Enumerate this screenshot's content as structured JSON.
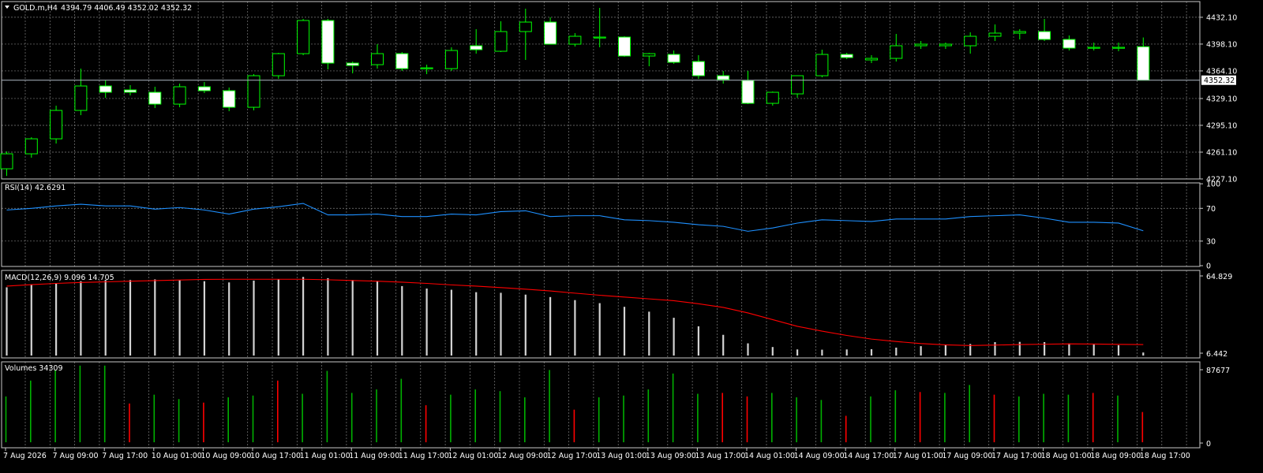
{
  "colors": {
    "background": "#000000",
    "grid": "#7f7f7f",
    "frame": "#c8c8c8",
    "bull": "#00ff00",
    "bear_fill": "#ffffff",
    "rsi": "#1e90ff",
    "macd_hist": "#d3d3d3",
    "macd_signal": "#ff0000",
    "vol_up": "#00b000",
    "vol_down": "#ff0000",
    "bid_line": "#aeb7c4",
    "price_tag_bg": "#ffffff",
    "price_tag_text": "#000000"
  },
  "main": {
    "title": "GOLD.m,H4",
    "ohlc_text": "4394.79 4406.49 4352.02 4352.32",
    "current_price": "4352.32"
  },
  "rsi_panel": {
    "label": "RSI(14) 42.6291"
  },
  "macd_panel": {
    "label": "MACD(12,26,9) 9.096 14.705"
  },
  "volume_panel": {
    "label": "Volumes 34309"
  },
  "chart_data": [
    {
      "type": "candlestick",
      "title": "GOLD.m,H4",
      "ylim": [
        4227.1,
        4452
      ],
      "yticks": [
        "4432.10",
        "4398.10",
        "4364.10",
        "4329.10",
        "4295.10",
        "4261.10",
        "4227.10"
      ],
      "xticks": [
        "7 Aug 2026",
        "7 Aug 09:00",
        "7 Aug 17:00",
        "10 Aug 01:00",
        "10 Aug 09:00",
        "10 Aug 17:00",
        "11 Aug 01:00",
        "11 Aug 09:00",
        "11 Aug 17:00",
        "12 Aug 01:00",
        "12 Aug 09:00",
        "12 Aug 17:00",
        "13 Aug 01:00",
        "13 Aug 09:00",
        "13 Aug 17:00",
        "14 Aug 01:00",
        "14 Aug 09:00",
        "14 Aug 17:00",
        "17 Aug 01:00",
        "17 Aug 09:00",
        "17 Aug 17:00",
        "18 Aug 01:00",
        "18 Aug 09:00",
        "18 Aug 17:00"
      ],
      "candles": [
        {
          "o": 4240,
          "h": 4262,
          "l": 4231,
          "c": 4259
        },
        {
          "o": 4259,
          "h": 4280,
          "l": 4254,
          "c": 4278
        },
        {
          "o": 4278,
          "h": 4320,
          "l": 4272,
          "c": 4314
        },
        {
          "o": 4314,
          "h": 4367,
          "l": 4308,
          "c": 4345
        },
        {
          "o": 4345,
          "h": 4352,
          "l": 4330,
          "c": 4337
        },
        {
          "o": 4340,
          "h": 4346,
          "l": 4333,
          "c": 4337
        },
        {
          "o": 4337,
          "h": 4344,
          "l": 4317,
          "c": 4322
        },
        {
          "o": 4322,
          "h": 4348,
          "l": 4318,
          "c": 4344
        },
        {
          "o": 4344,
          "h": 4350,
          "l": 4336,
          "c": 4339
        },
        {
          "o": 4339,
          "h": 4343,
          "l": 4313,
          "c": 4318
        },
        {
          "o": 4318,
          "h": 4360,
          "l": 4314,
          "c": 4358
        },
        {
          "o": 4358,
          "h": 4387,
          "l": 4354,
          "c": 4386
        },
        {
          "o": 4386,
          "h": 4430,
          "l": 4384,
          "c": 4428
        },
        {
          "o": 4428,
          "h": 4430,
          "l": 4366,
          "c": 4374
        },
        {
          "o": 4374,
          "h": 4376,
          "l": 4361,
          "c": 4371
        },
        {
          "o": 4372,
          "h": 4398,
          "l": 4367,
          "c": 4386
        },
        {
          "o": 4386,
          "h": 4388,
          "l": 4364,
          "c": 4367
        },
        {
          "o": 4367,
          "h": 4372,
          "l": 4360,
          "c": 4368
        },
        {
          "o": 4367,
          "h": 4394,
          "l": 4364,
          "c": 4390
        },
        {
          "o": 4396,
          "h": 4417,
          "l": 4386,
          "c": 4391
        },
        {
          "o": 4389,
          "h": 4427,
          "l": 4388,
          "c": 4414
        },
        {
          "o": 4414,
          "h": 4443,
          "l": 4378,
          "c": 4426
        },
        {
          "o": 4426,
          "h": 4432,
          "l": 4398,
          "c": 4398
        },
        {
          "o": 4398,
          "h": 4412,
          "l": 4395,
          "c": 4408
        },
        {
          "o": 4406,
          "h": 4444,
          "l": 4394,
          "c": 4407
        },
        {
          "o": 4407,
          "h": 4408,
          "l": 4382,
          "c": 4383
        },
        {
          "o": 4383,
          "h": 4387,
          "l": 4370,
          "c": 4386
        },
        {
          "o": 4385,
          "h": 4390,
          "l": 4373,
          "c": 4375
        },
        {
          "o": 4376,
          "h": 4384,
          "l": 4354,
          "c": 4358
        },
        {
          "o": 4358,
          "h": 4364,
          "l": 4348,
          "c": 4353
        },
        {
          "o": 4352,
          "h": 4364,
          "l": 4322,
          "c": 4323
        },
        {
          "o": 4323,
          "h": 4338,
          "l": 4320,
          "c": 4337
        },
        {
          "o": 4335,
          "h": 4358,
          "l": 4330,
          "c": 4358
        },
        {
          "o": 4358,
          "h": 4391,
          "l": 4356,
          "c": 4385
        },
        {
          "o": 4385,
          "h": 4387,
          "l": 4379,
          "c": 4381
        },
        {
          "o": 4378,
          "h": 4384,
          "l": 4374,
          "c": 4380
        },
        {
          "o": 4380,
          "h": 4411,
          "l": 4376,
          "c": 4396
        },
        {
          "o": 4396,
          "h": 4402,
          "l": 4392,
          "c": 4398
        },
        {
          "o": 4396,
          "h": 4400,
          "l": 4392,
          "c": 4398
        },
        {
          "o": 4396,
          "h": 4413,
          "l": 4386,
          "c": 4408
        },
        {
          "o": 4408,
          "h": 4423,
          "l": 4402,
          "c": 4412
        },
        {
          "o": 4412,
          "h": 4417,
          "l": 4404,
          "c": 4414
        },
        {
          "o": 4414,
          "h": 4430,
          "l": 4402,
          "c": 4404
        },
        {
          "o": 4404,
          "h": 4409,
          "l": 4390,
          "c": 4393
        },
        {
          "o": 4393,
          "h": 4400,
          "l": 4390,
          "c": 4394
        },
        {
          "o": 4394,
          "h": 4400,
          "l": 4389,
          "c": 4394
        },
        {
          "o": 4394.79,
          "h": 4406.49,
          "l": 4352.02,
          "c": 4352.32
        }
      ]
    },
    {
      "type": "line",
      "title": "RSI(14) 42.6291",
      "ylim": [
        0,
        100
      ],
      "yticks": [
        "100",
        "70",
        "30",
        "0"
      ],
      "values": [
        68,
        70,
        73,
        75,
        73,
        73,
        69,
        71,
        68,
        63,
        69,
        72,
        76,
        62,
        62,
        63,
        60,
        60,
        63,
        62,
        66,
        67,
        60,
        61,
        61,
        56,
        55,
        53,
        50,
        48,
        42,
        46,
        52,
        56,
        55,
        54,
        57,
        57,
        57,
        60,
        61,
        62,
        58,
        53,
        53,
        52,
        42.6
      ]
    },
    {
      "type": "bar+line",
      "title": "MACD(12,26,9) 9.096 14.705",
      "ylim": [
        0,
        66
      ],
      "yticks": [
        "64.829",
        "6.442"
      ],
      "histogram": [
        56,
        58,
        59.5,
        61,
        62,
        62,
        62.5,
        62,
        61,
        60,
        61.5,
        62.5,
        64.5,
        63.5,
        62,
        61,
        57,
        55,
        54,
        52,
        51.5,
        50,
        48,
        45.5,
        43,
        40,
        36,
        31,
        24,
        17,
        10,
        7,
        5,
        4.8,
        5,
        5.2,
        6.5,
        7.7,
        8.5,
        9.5,
        11,
        11.2,
        11,
        10,
        9,
        8.5,
        2.5
      ],
      "signal": [
        57,
        58.2,
        59.2,
        60,
        60.5,
        61,
        61.5,
        62,
        62.5,
        62.6,
        62.6,
        62.6,
        62.6,
        62.2,
        61.6,
        61,
        60.2,
        59.2,
        58,
        57,
        55.8,
        54.5,
        53,
        51.2,
        49.5,
        48,
        46.5,
        45,
        42.5,
        39.5,
        35,
        29.5,
        24,
        20,
        16.5,
        13.5,
        11.5,
        9.8,
        8.8,
        8.2,
        8.6,
        9,
        9.3,
        9.6,
        9.4,
        9.2,
        9
      ]
    },
    {
      "type": "bar",
      "title": "Volumes 34309",
      "ylim": [
        0,
        87677
      ],
      "yticks": [
        "87677",
        "0"
      ],
      "values": [
        52000,
        70000,
        82000,
        87000,
        87000,
        44000,
        54000,
        49000,
        45000,
        51000,
        53000,
        70000,
        55000,
        81000,
        56000,
        60000,
        72000,
        42000,
        54000,
        60000,
        58000,
        51000,
        82000,
        37000,
        51000,
        53000,
        60000,
        78000,
        55000,
        56000,
        52000,
        56000,
        51000,
        48000,
        30000,
        52000,
        59000,
        57000,
        56000,
        65000,
        54000,
        52000,
        55000,
        54000,
        56000,
        53000,
        34309
      ],
      "up": [
        1,
        1,
        1,
        1,
        1,
        0,
        1,
        1,
        0,
        1,
        1,
        0,
        1,
        1,
        1,
        1,
        1,
        0,
        1,
        1,
        1,
        1,
        1,
        0,
        1,
        1,
        1,
        1,
        1,
        0,
        0,
        1,
        1,
        1,
        0,
        1,
        1,
        0,
        1,
        1,
        0,
        1,
        1,
        1,
        0,
        1,
        0
      ]
    }
  ]
}
